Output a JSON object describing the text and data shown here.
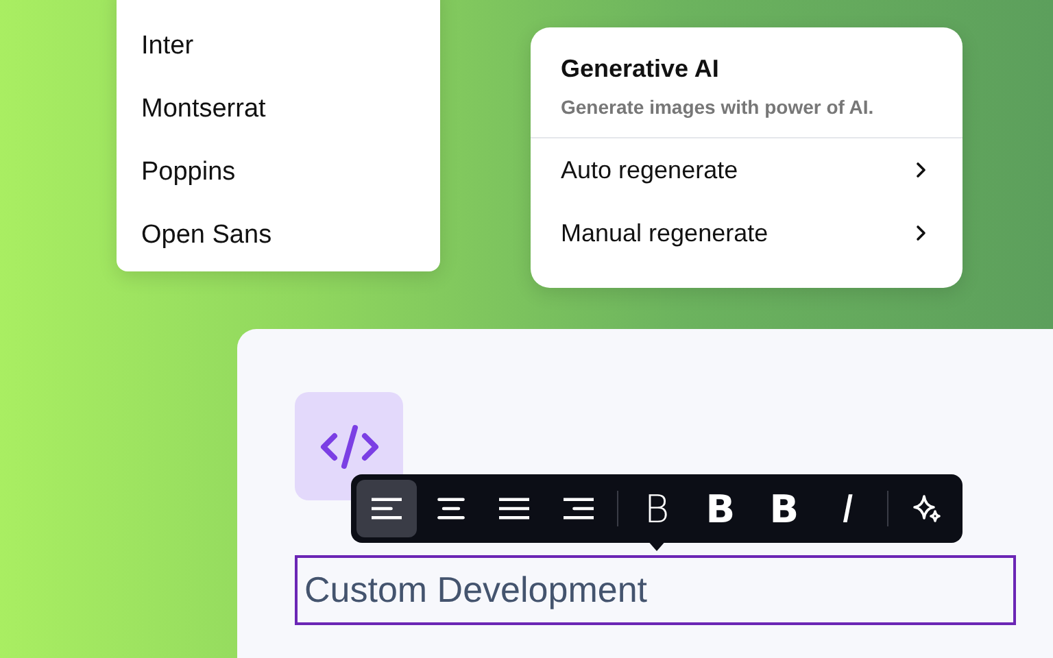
{
  "font_menu": {
    "items": [
      {
        "label": "Inter"
      },
      {
        "label": "Montserrat"
      },
      {
        "label": "Poppins"
      },
      {
        "label": "Open Sans"
      }
    ]
  },
  "ai_menu": {
    "title": "Generative AI",
    "subtitle": "Generate images with power of AI.",
    "items": [
      {
        "label": "Auto regenerate"
      },
      {
        "label": "Manual regenerate"
      }
    ]
  },
  "card": {
    "heading": "Custom Development"
  },
  "toolbar": {
    "items": [
      {
        "kind": "align-left",
        "selected": true
      },
      {
        "kind": "align-center",
        "selected": false
      },
      {
        "kind": "justify",
        "selected": false
      },
      {
        "kind": "align-right",
        "selected": false
      },
      {
        "kind": "divider"
      },
      {
        "kind": "weight-light",
        "label": "B",
        "selected": false
      },
      {
        "kind": "weight-bold",
        "label": "B",
        "selected": false
      },
      {
        "kind": "weight-heavy",
        "label": "B",
        "selected": false
      },
      {
        "kind": "italic",
        "label": "I",
        "selected": false
      },
      {
        "kind": "divider"
      },
      {
        "kind": "sparkle",
        "selected": false
      }
    ]
  }
}
